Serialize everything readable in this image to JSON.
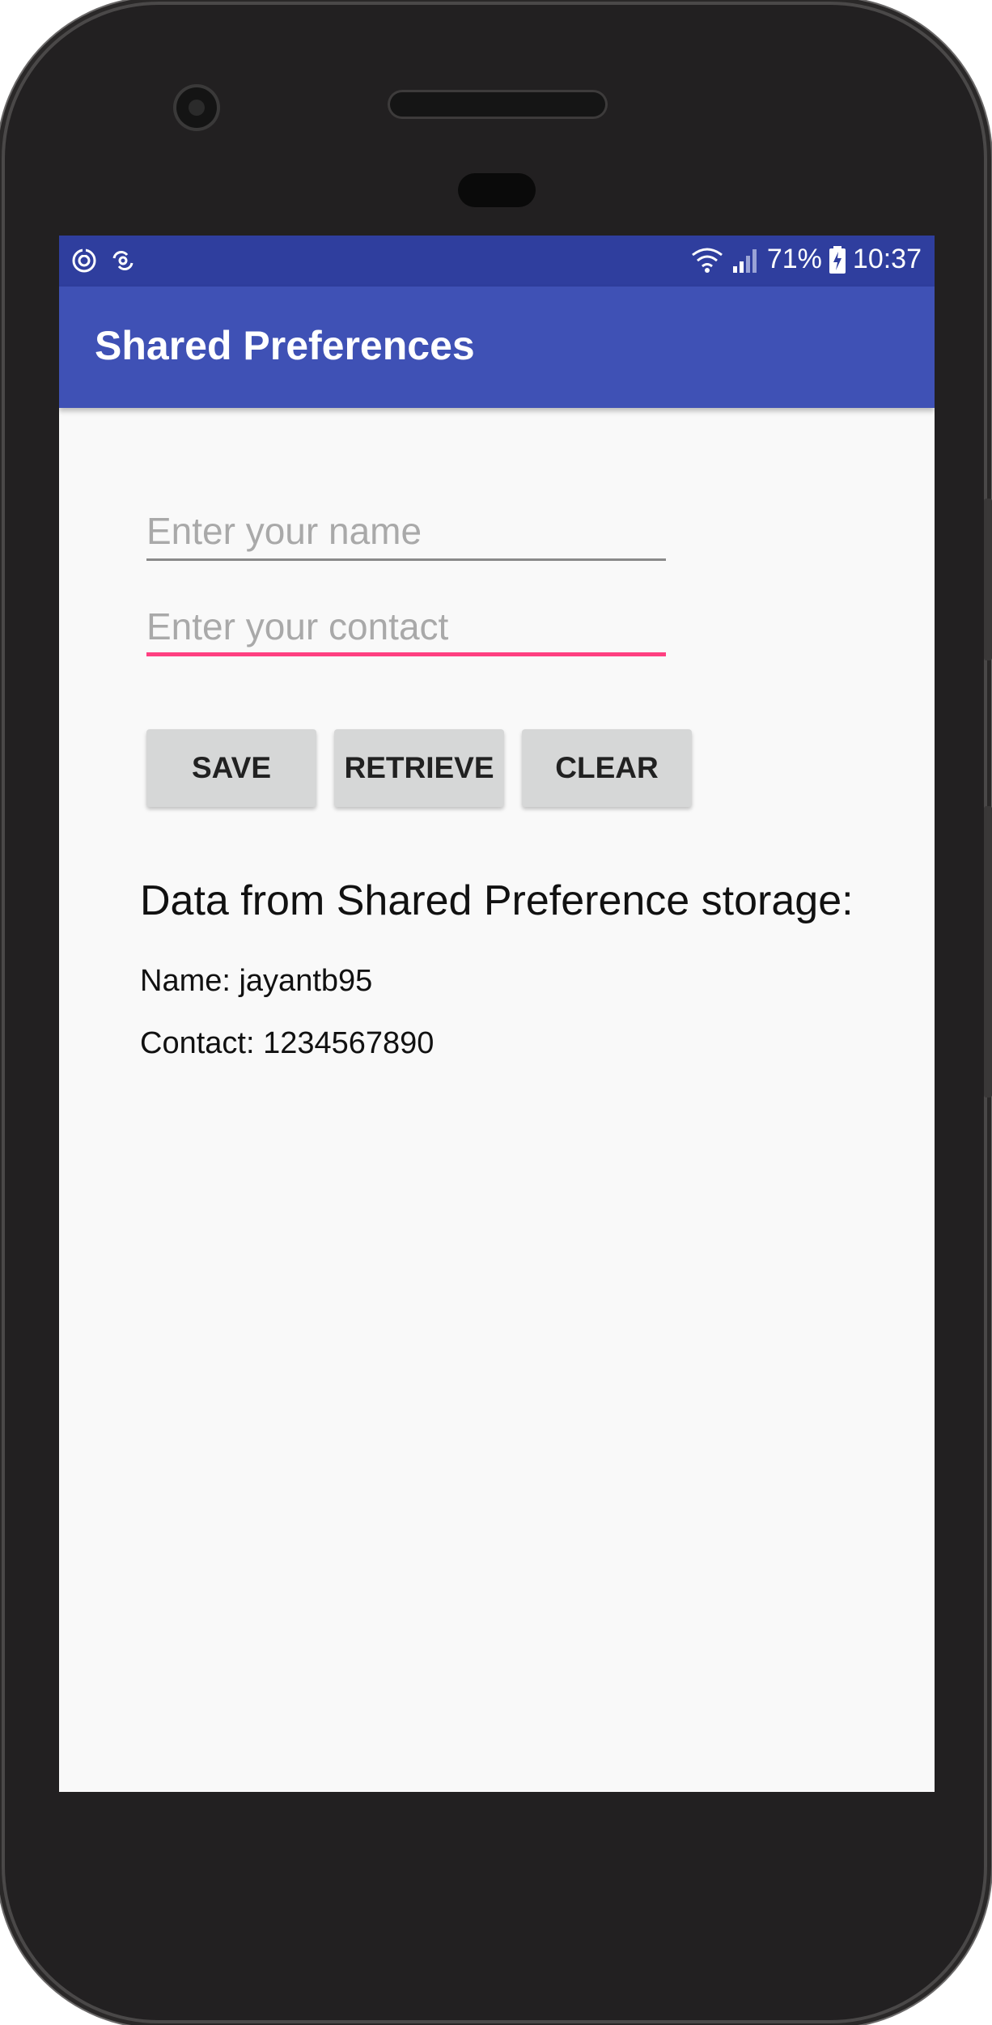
{
  "status_bar": {
    "left_icons": [
      "data-saver-icon",
      "sync-icon"
    ],
    "wifi_icon": "wifi-icon",
    "signal_icon": "cell-signal-icon",
    "battery_percent": "71%",
    "battery_icon": "battery-charging-icon",
    "time": "10:37"
  },
  "app_bar": {
    "title": "Shared Preferences"
  },
  "form": {
    "name_placeholder": "Enter your name",
    "name_value": "",
    "contact_placeholder": "Enter your contact",
    "contact_value": ""
  },
  "buttons": {
    "save_label": "SAVE",
    "retrieve_label": "RETRIEVE",
    "clear_label": "CLEAR"
  },
  "output": {
    "heading": "Data from Shared Preference storage:",
    "name_line": "Name: jayantb95",
    "contact_line": "Contact: 1234567890"
  },
  "colors": {
    "status_bar": "#2f3e9e",
    "app_bar": "#3f51b5",
    "accent": "#ff4081",
    "background": "#f9f9f9",
    "button": "#d6d7d7"
  }
}
